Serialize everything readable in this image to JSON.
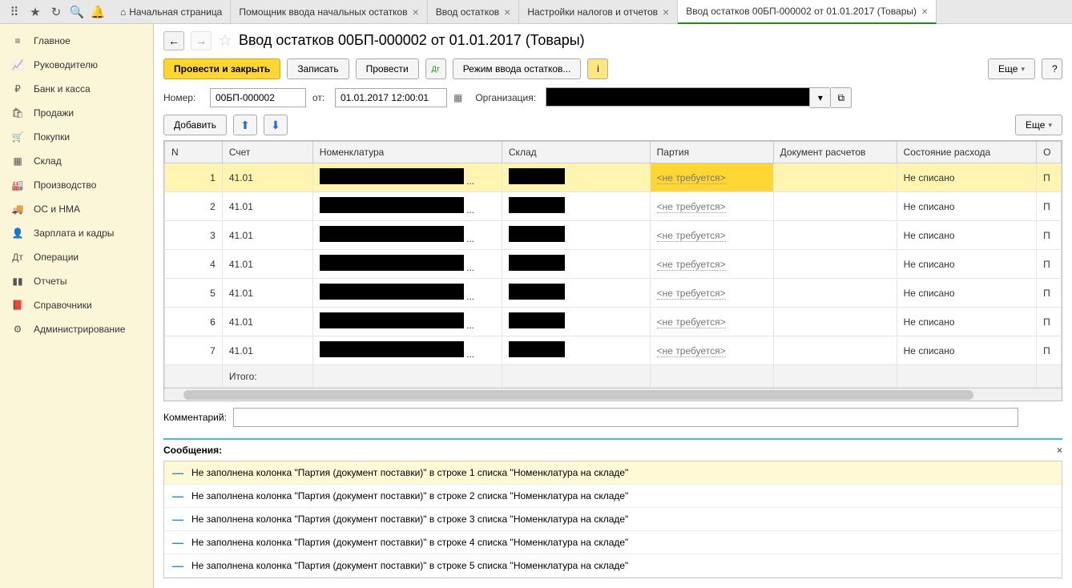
{
  "tabs": [
    {
      "label": "Начальная страница",
      "home": true
    },
    {
      "label": "Помощник ввода начальных остатков",
      "close": true
    },
    {
      "label": "Ввод остатков",
      "close": true
    },
    {
      "label": "Настройки налогов и отчетов",
      "close": true
    },
    {
      "label": "Ввод остатков 00БП-000002 от 01.01.2017 (Товары)",
      "close": true,
      "active": true
    }
  ],
  "sidebar": [
    {
      "icon": "≡",
      "label": "Главное"
    },
    {
      "icon": "📈",
      "label": "Руководителю"
    },
    {
      "icon": "₽",
      "label": "Банк и касса"
    },
    {
      "icon": "🛍",
      "label": "Продажи"
    },
    {
      "icon": "🛒",
      "label": "Покупки"
    },
    {
      "icon": "▦",
      "label": "Склад"
    },
    {
      "icon": "🏭",
      "label": "Производство"
    },
    {
      "icon": "🚚",
      "label": "ОС и НМА"
    },
    {
      "icon": "👤",
      "label": "Зарплата и кадры"
    },
    {
      "icon": "Дт",
      "label": "Операции"
    },
    {
      "icon": "▮▮",
      "label": "Отчеты"
    },
    {
      "icon": "📕",
      "label": "Справочники"
    },
    {
      "icon": "⚙",
      "label": "Администрирование"
    }
  ],
  "page_title": "Ввод остатков 00БП-000002 от 01.01.2017 (Товары)",
  "actions": {
    "post_close": "Провести и закрыть",
    "save": "Записать",
    "post": "Провести",
    "mode": "Режим ввода остатков...",
    "more": "Еще",
    "add": "Добавить"
  },
  "form": {
    "number_label": "Номер:",
    "number": "00БП-000002",
    "from_label": "от:",
    "date": "01.01.2017 12:00:01",
    "org_label": "Организация:"
  },
  "table": {
    "headers": {
      "n": "N",
      "acc": "Счет",
      "nom": "Номенклатура",
      "wh": "Склад",
      "batch": "Партия",
      "doc": "Документ расчетов",
      "state": "Состояние расхода",
      "p": "О"
    },
    "batch_ph": "<не требуется>",
    "state_val": "Не списано",
    "p_val": "П",
    "rows": [
      {
        "n": "1",
        "acc": "41.01",
        "selected": true
      },
      {
        "n": "2",
        "acc": "41.01"
      },
      {
        "n": "3",
        "acc": "41.01"
      },
      {
        "n": "4",
        "acc": "41.01"
      },
      {
        "n": "5",
        "acc": "41.01"
      },
      {
        "n": "6",
        "acc": "41.01"
      },
      {
        "n": "7",
        "acc": "41.01"
      }
    ],
    "total_label": "Итого:"
  },
  "comment_label": "Комментарий:",
  "messages_header": "Сообщения:",
  "messages": [
    "Не заполнена колонка \"Партия (документ поставки)\" в строке 1 списка \"Номенклатура на складе\"",
    "Не заполнена колонка \"Партия (документ поставки)\" в строке 2 списка \"Номенклатура на складе\"",
    "Не заполнена колонка \"Партия (документ поставки)\" в строке 3 списка \"Номенклатура на складе\"",
    "Не заполнена колонка \"Партия (документ поставки)\" в строке 4 списка \"Номенклатура на складе\"",
    "Не заполнена колонка \"Партия (документ поставки)\" в строке 5 списка \"Номенклатура на складе\""
  ]
}
